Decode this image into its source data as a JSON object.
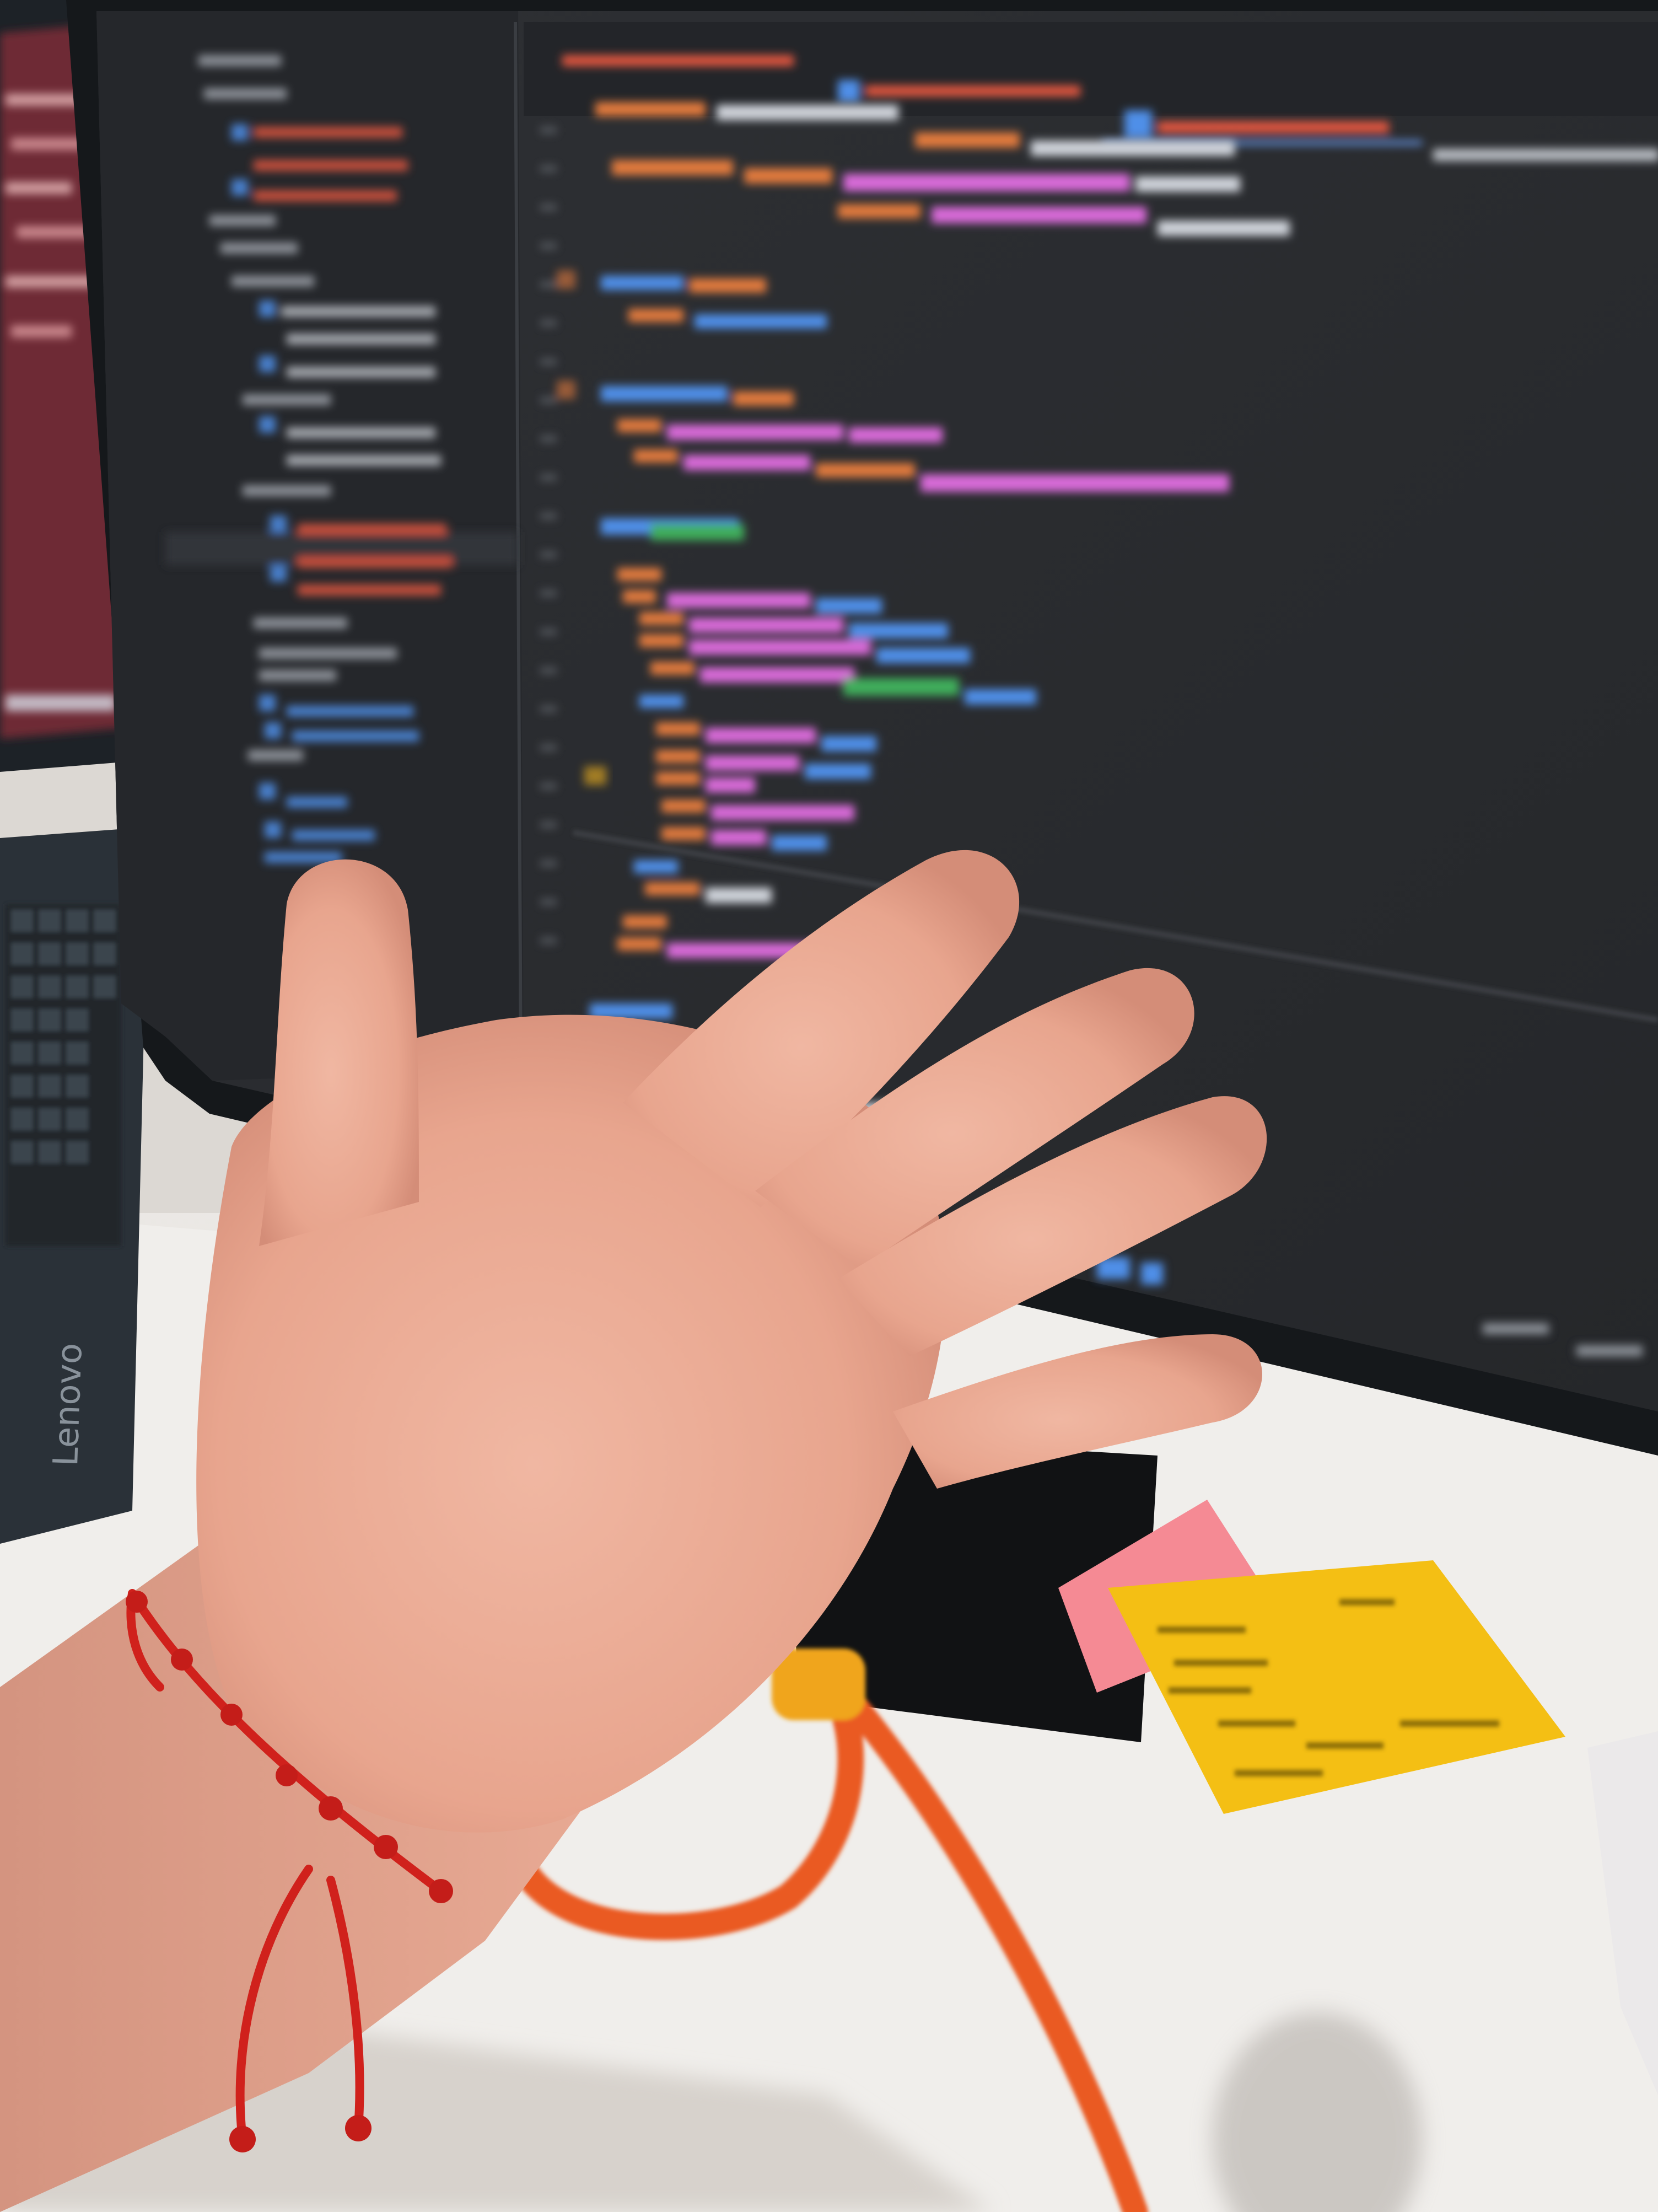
{
  "photo": {
    "laptop_logo": "Lenovo"
  },
  "colors": {
    "desk": "#f1efec",
    "wall": "#ded9d4",
    "monitor_bezel": "#17191c",
    "editor_bg": "#2b2d31",
    "sidebar_bg": "#25272b",
    "code_pink": "#d86ad8",
    "code_orange": "#e27a3e",
    "code_blue": "#4f8fe8",
    "code_green": "#3fae5b",
    "code_white": "#cfd3da",
    "laptop_body": "#2a3138",
    "laptop_screen": "#6e2a35",
    "sticky_yellow": "#f4bf14",
    "sticky_pink": "#f58a94",
    "cable_orange": "#ea5a22",
    "bracelet_red": "#d0211c",
    "skin": "#efb29c"
  }
}
